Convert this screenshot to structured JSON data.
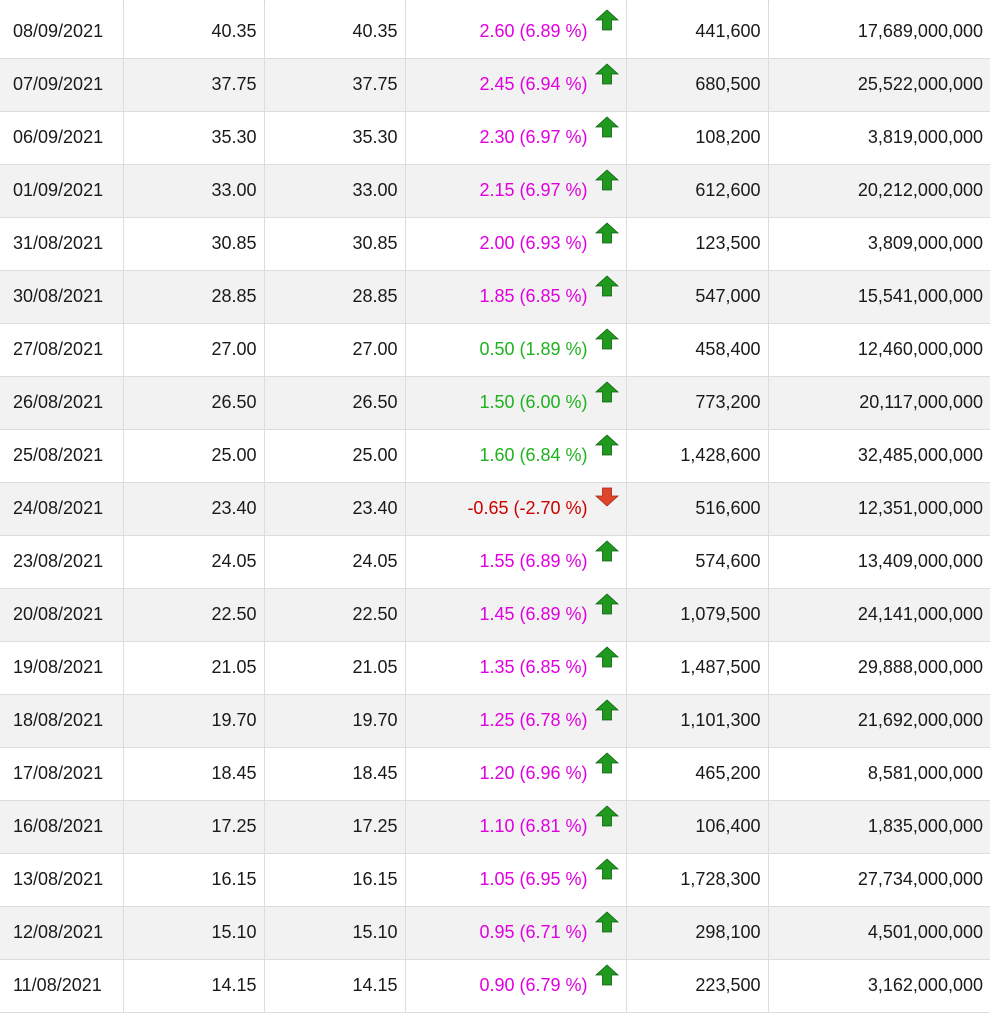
{
  "colors": {
    "ceiling": "#e000e0",
    "up": "#1fb21f",
    "down": "#cc0000",
    "arrow_up": "#1f9a1f",
    "arrow_down": "#e0452a",
    "row_alt": "#f2f2f2",
    "grid": "#dddddd"
  },
  "table": {
    "rows": [
      {
        "date": "08/09/2021",
        "col2": "40.35",
        "col3": "40.35",
        "change": "2.60 (6.89 %)",
        "tone": "magenta",
        "arrow": "up-arrow-icon",
        "volume": "441,600",
        "value": "17,689,000,000"
      },
      {
        "date": "07/09/2021",
        "col2": "37.75",
        "col3": "37.75",
        "change": "2.45 (6.94 %)",
        "tone": "magenta",
        "arrow": "up-arrow-icon",
        "volume": "680,500",
        "value": "25,522,000,000"
      },
      {
        "date": "06/09/2021",
        "col2": "35.30",
        "col3": "35.30",
        "change": "2.30 (6.97 %)",
        "tone": "magenta",
        "arrow": "up-arrow-icon",
        "volume": "108,200",
        "value": "3,819,000,000"
      },
      {
        "date": "01/09/2021",
        "col2": "33.00",
        "col3": "33.00",
        "change": "2.15 (6.97 %)",
        "tone": "magenta",
        "arrow": "up-arrow-icon",
        "volume": "612,600",
        "value": "20,212,000,000"
      },
      {
        "date": "31/08/2021",
        "col2": "30.85",
        "col3": "30.85",
        "change": "2.00 (6.93 %)",
        "tone": "magenta",
        "arrow": "up-arrow-icon",
        "volume": "123,500",
        "value": "3,809,000,000"
      },
      {
        "date": "30/08/2021",
        "col2": "28.85",
        "col3": "28.85",
        "change": "1.85 (6.85 %)",
        "tone": "magenta",
        "arrow": "up-arrow-icon",
        "volume": "547,000",
        "value": "15,541,000,000"
      },
      {
        "date": "27/08/2021",
        "col2": "27.00",
        "col3": "27.00",
        "change": "0.50 (1.89 %)",
        "tone": "green",
        "arrow": "up-arrow-icon",
        "volume": "458,400",
        "value": "12,460,000,000"
      },
      {
        "date": "26/08/2021",
        "col2": "26.50",
        "col3": "26.50",
        "change": "1.50 (6.00 %)",
        "tone": "green",
        "arrow": "up-arrow-icon",
        "volume": "773,200",
        "value": "20,117,000,000"
      },
      {
        "date": "25/08/2021",
        "col2": "25.00",
        "col3": "25.00",
        "change": "1.60 (6.84 %)",
        "tone": "green",
        "arrow": "up-arrow-icon",
        "volume": "1,428,600",
        "value": "32,485,000,000"
      },
      {
        "date": "24/08/2021",
        "col2": "23.40",
        "col3": "23.40",
        "change": "-0.65 (-2.70 %)",
        "tone": "red",
        "arrow": "down-arrow-icon",
        "volume": "516,600",
        "value": "12,351,000,000"
      },
      {
        "date": "23/08/2021",
        "col2": "24.05",
        "col3": "24.05",
        "change": "1.55 (6.89 %)",
        "tone": "magenta",
        "arrow": "up-arrow-icon",
        "volume": "574,600",
        "value": "13,409,000,000"
      },
      {
        "date": "20/08/2021",
        "col2": "22.50",
        "col3": "22.50",
        "change": "1.45 (6.89 %)",
        "tone": "magenta",
        "arrow": "up-arrow-icon",
        "volume": "1,079,500",
        "value": "24,141,000,000"
      },
      {
        "date": "19/08/2021",
        "col2": "21.05",
        "col3": "21.05",
        "change": "1.35 (6.85 %)",
        "tone": "magenta",
        "arrow": "up-arrow-icon",
        "volume": "1,487,500",
        "value": "29,888,000,000"
      },
      {
        "date": "18/08/2021",
        "col2": "19.70",
        "col3": "19.70",
        "change": "1.25 (6.78 %)",
        "tone": "magenta",
        "arrow": "up-arrow-icon",
        "volume": "1,101,300",
        "value": "21,692,000,000"
      },
      {
        "date": "17/08/2021",
        "col2": "18.45",
        "col3": "18.45",
        "change": "1.20 (6.96 %)",
        "tone": "magenta",
        "arrow": "up-arrow-icon",
        "volume": "465,200",
        "value": "8,581,000,000"
      },
      {
        "date": "16/08/2021",
        "col2": "17.25",
        "col3": "17.25",
        "change": "1.10 (6.81 %)",
        "tone": "magenta",
        "arrow": "up-arrow-icon",
        "volume": "106,400",
        "value": "1,835,000,000"
      },
      {
        "date": "13/08/2021",
        "col2": "16.15",
        "col3": "16.15",
        "change": "1.05 (6.95 %)",
        "tone": "magenta",
        "arrow": "up-arrow-icon",
        "volume": "1,728,300",
        "value": "27,734,000,000"
      },
      {
        "date": "12/08/2021",
        "col2": "15.10",
        "col3": "15.10",
        "change": "0.95 (6.71 %)",
        "tone": "magenta",
        "arrow": "up-arrow-icon",
        "volume": "298,100",
        "value": "4,501,000,000"
      },
      {
        "date": "11/08/2021",
        "col2": "14.15",
        "col3": "14.15",
        "change": "0.90 (6.79 %)",
        "tone": "magenta",
        "arrow": "up-arrow-icon",
        "volume": "223,500",
        "value": "3,162,000,000"
      }
    ]
  }
}
